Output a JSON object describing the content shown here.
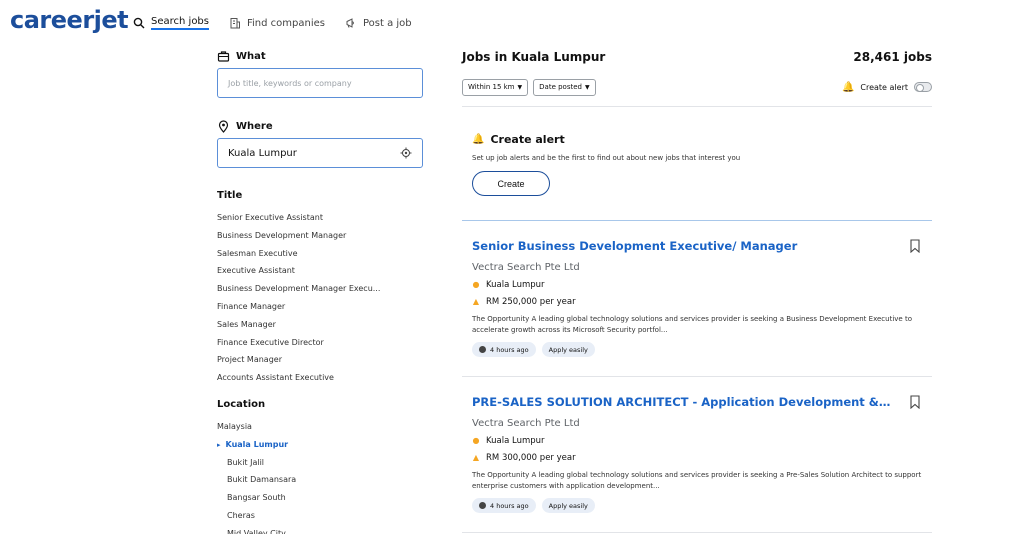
{
  "header": {
    "logo": "careerjet",
    "nav": [
      {
        "label": "Search jobs",
        "icon": "search-icon"
      },
      {
        "label": "Find companies",
        "icon": "building-icon"
      },
      {
        "label": "Post a job",
        "icon": "megaphone-icon"
      }
    ]
  },
  "search": {
    "what_label": "What",
    "what_placeholder": "Job title, keywords or company",
    "where_label": "Where",
    "where_value": "Kuala Lumpur"
  },
  "filters": {
    "title_heading": "Title",
    "titles": [
      "Senior Executive Assistant",
      "Business Development Manager",
      "Salesman Executive",
      "Executive Assistant",
      "Business Development Manager Execu...",
      "Finance Manager",
      "Sales Manager",
      "Finance Executive Director",
      "Project Manager",
      "Accounts Assistant Executive"
    ],
    "location_heading": "Location",
    "locations": [
      "Malaysia",
      "Kuala Lumpur",
      "Bukit Jalil",
      "Bukit Damansara",
      "Bangsar South",
      "Cheras",
      "Mid Valley City"
    ]
  },
  "results": {
    "title": "Jobs in Kuala Lumpur",
    "count": "28,461 jobs",
    "filter_distance": "Within 15 km",
    "filter_date": "Date posted",
    "create_alert_toggle": "Create alert"
  },
  "alert_box": {
    "title": "Create alert",
    "text": "Set up job alerts and be the first to find out about new jobs that interest you",
    "button": "Create"
  },
  "jobs": [
    {
      "title": "Senior Business Development Executive/ Manager",
      "company": "Vectra Search Pte Ltd",
      "location": "Kuala Lumpur",
      "salary": "RM 250,000 per year",
      "description": "The Opportunity A leading global technology solutions and services provider is seeking a Business Development Executive to accelerate growth across its Microsoft Security portfol...",
      "posted": "4 hours ago",
      "apply": "Apply easily"
    },
    {
      "title": "PRE-SALES SOLUTION ARCHITECT - Application Development & Mode...",
      "company": "Vectra Search Pte Ltd",
      "location": "Kuala Lumpur",
      "salary": "RM 300,000 per year",
      "description": "The Opportunity A leading global technology solutions and services provider is seeking a Pre-Sales Solution Architect to support enterprise customers with application development...",
      "posted": "4 hours ago",
      "apply": "Apply easily"
    }
  ],
  "colors": {
    "brand": "#1c4e9b",
    "link": "#1a63c6",
    "accent": "#f5a623"
  }
}
